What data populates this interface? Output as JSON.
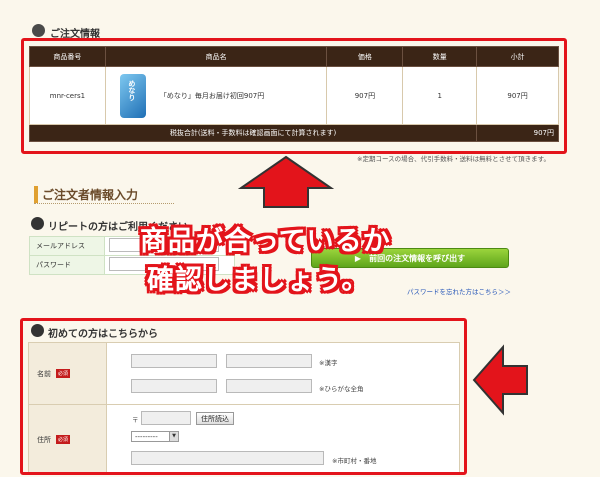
{
  "order_section": {
    "title": "ご注文情報",
    "columns": [
      "商品番号",
      "商品名",
      "価格",
      "数量",
      "小計"
    ],
    "rows": [
      {
        "code": "mnr-cers1",
        "product_name": "「めなり」毎月お届け初回907円",
        "price": "907円",
        "qty": "1",
        "subtotal": "907円"
      }
    ],
    "product_package_text": "めなり",
    "total_label": "税抜合計(送料・手数料は確認画面にて計算されます)",
    "total_value": "907円",
    "footnote": "※定期コースの場合、代引手数料・送料は無料とさせて頂きます。"
  },
  "customer_section": {
    "title": "ご注文者情報入力",
    "repeat": {
      "title": "リピートの方はご利用ください",
      "email_label": "メールアドレス",
      "password_label": "パスワード",
      "recall_button": "前回の注文情報を呼び出す",
      "forgot_link": "パスワードを忘れた方はこちら＞＞"
    },
    "first_time": {
      "title": "初めての方はこちらから",
      "name_label": "名前",
      "required_badge": "必須",
      "kanji_hint": "※漢字",
      "hiragana_hint": "※ひらがな全角",
      "address_label": "住所",
      "postal_mark": "〒",
      "postal_button": "住所読込",
      "prefecture_select": "---------",
      "city_hint": "※市町村・番地"
    }
  },
  "annotation": {
    "line1": "商品が合っているか",
    "line2": "確認しましょう。"
  },
  "colors": {
    "header_brown": "#3b2516",
    "highlight_red": "#e3141b",
    "button_green": "#5ea51b",
    "page_bg": "#fbf7ec"
  }
}
